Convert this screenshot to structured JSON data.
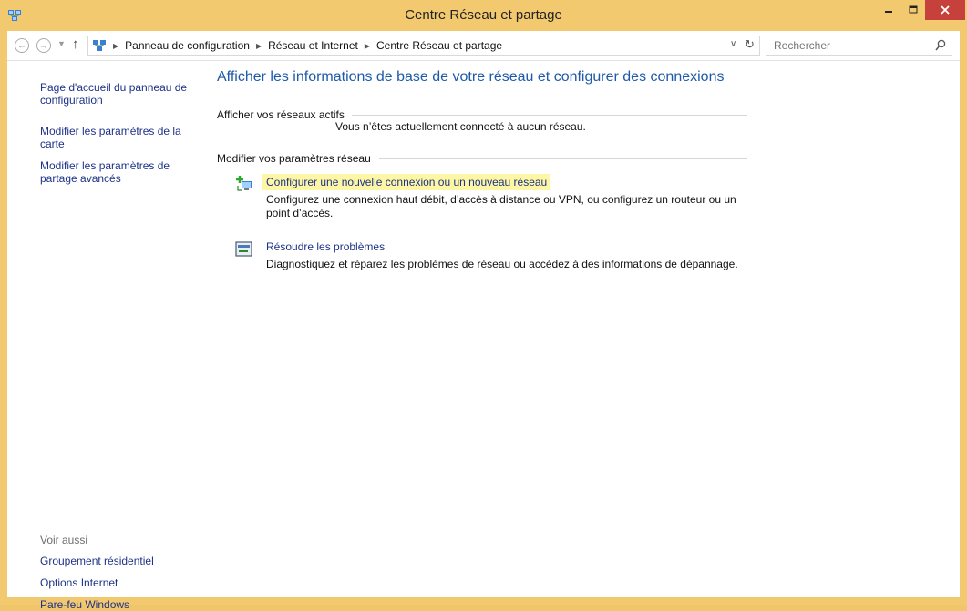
{
  "window": {
    "title": "Centre Réseau et partage",
    "min_icon": "minimize-icon",
    "max_icon": "maximize-icon",
    "close_icon": "close-icon"
  },
  "addressbar": {
    "crumbs": [
      "Panneau de configuration",
      "Réseau et Internet",
      "Centre Réseau et partage"
    ],
    "search_placeholder": "Rechercher"
  },
  "leftpane": {
    "links": [
      "Page d'accueil du panneau de configuration",
      "Modifier les paramètres de la carte",
      "Modifier les paramètres de partage avancés"
    ],
    "see_also_label": "Voir aussi",
    "see_also": [
      "Groupement résidentiel",
      "Options Internet",
      "Pare-feu Windows"
    ]
  },
  "main": {
    "heading": "Afficher les informations de base de votre réseau et configurer des connexions",
    "active_networks_label": "Afficher vos réseaux actifs",
    "not_connected_text": "Vous n’êtes actuellement connecté à aucun réseau.",
    "modify_label": "Modifier vos paramètres réseau",
    "tasks": [
      {
        "icon": "new-connection-icon",
        "link": "Configurer une nouvelle connexion ou un nouveau réseau",
        "description": "Configurez une connexion haut débit, d’accès à distance ou VPN, ou configurez un routeur ou un point d’accès."
      },
      {
        "icon": "troubleshoot-icon",
        "link": "Résoudre les problèmes",
        "description": "Diagnostiquez et réparez les problèmes de réseau ou accédez à des informations de dépannage."
      }
    ]
  },
  "colors": {
    "frame": "#f3c970",
    "link": "#1e3287",
    "heading": "#1e5aa8",
    "highlight": "#fdf6a5",
    "close_button": "#c7413c"
  }
}
